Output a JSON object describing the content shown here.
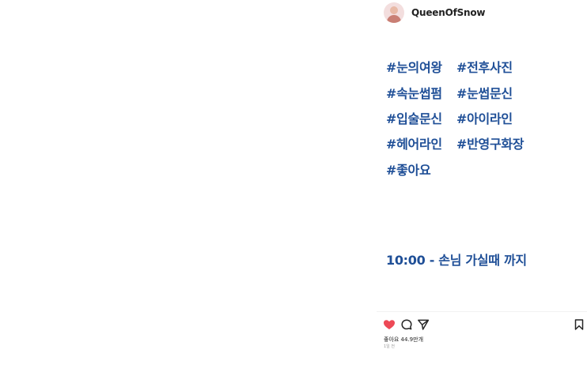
{
  "post": {
    "username": "QueenOfSnow",
    "hashtags": [
      "#눈의여왕",
      "#전후사진",
      "#속눈썹펌",
      "#눈썹문신",
      "#입술문신",
      "#아이라인",
      "#헤어라인",
      "#반영구화장",
      "#좋아요"
    ],
    "hours_text": "10:00 - 손님 가실때 까지",
    "likes_text": "좋아요 44.9만개",
    "time_ago": "1일 전",
    "like_color": "#ed4956",
    "tag_color": "#1f4f97"
  },
  "icons": {
    "avatar": "profile-avatar",
    "like": "heart-icon",
    "comment": "comment-icon",
    "share": "send-icon",
    "save": "bookmark-icon"
  }
}
